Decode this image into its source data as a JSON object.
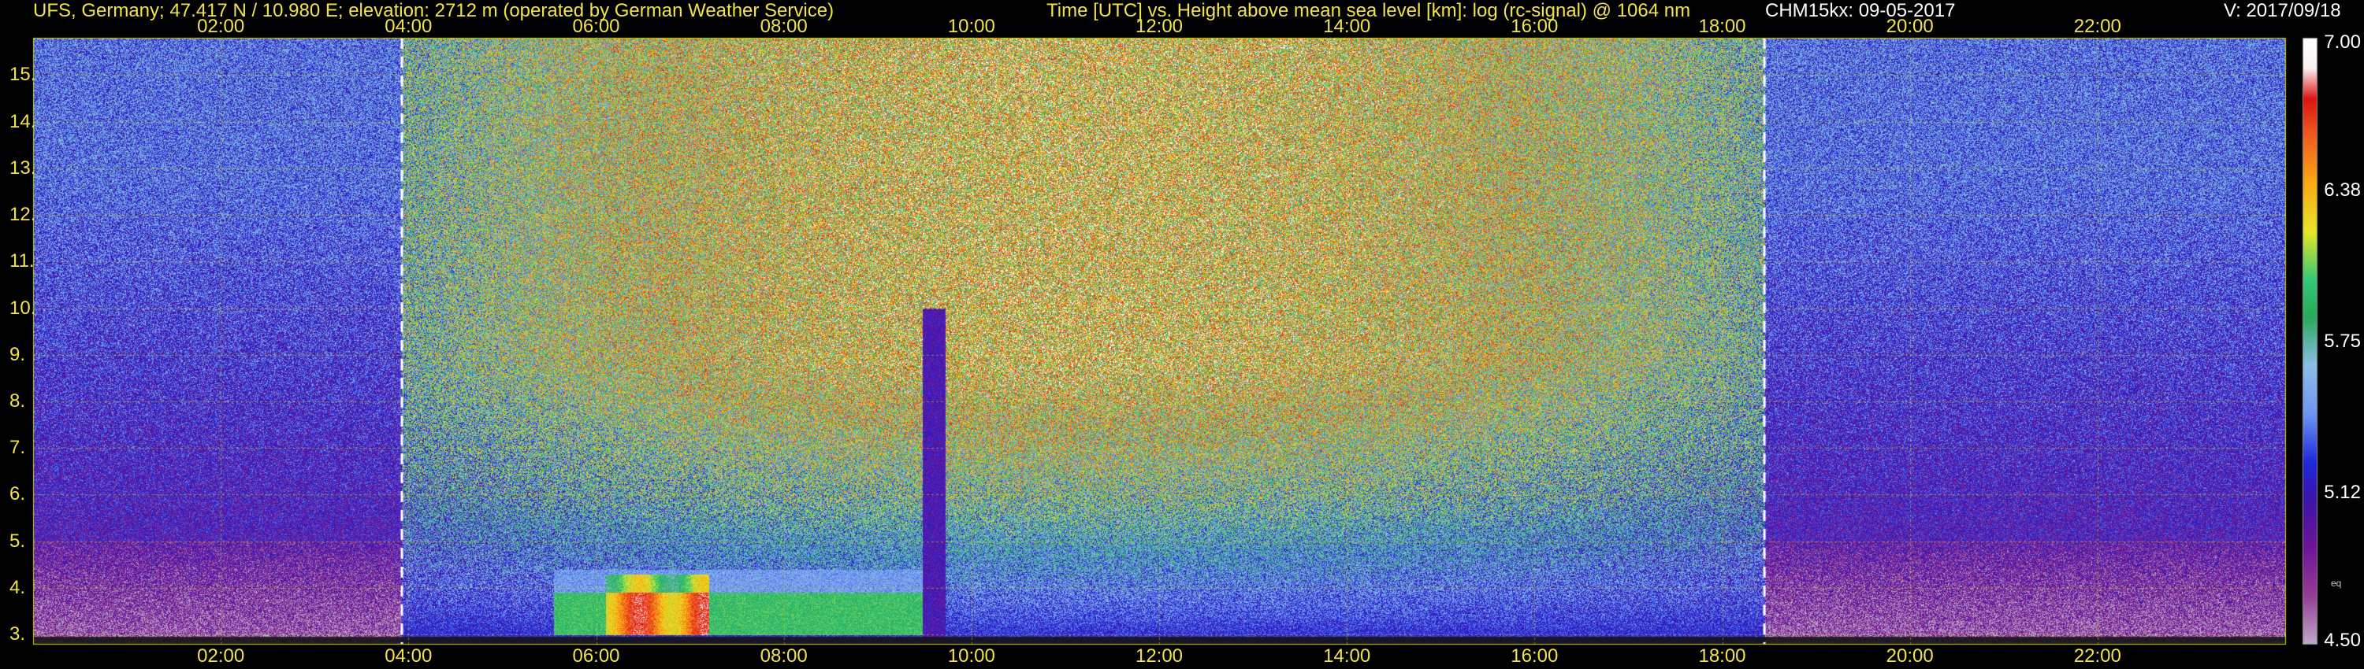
{
  "header": {
    "station": "UFS, Germany; 47.417 N / 10.980 E; elevation: 2712 m  (operated by German Weather Service)",
    "description": "Time [UTC] vs. Height above mean sea level [km]: log (rc-signal) @ 1064 nm",
    "instrument_date": "CHM15kx: 09-05-2017",
    "version": "V: 2017/09/18"
  },
  "chart_data": {
    "type": "heatmap",
    "x_ticks": [
      "02:00",
      "04:00",
      "06:00",
      "08:00",
      "10:00",
      "12:00",
      "14:00",
      "16:00",
      "18:00",
      "20:00",
      "22:00"
    ],
    "x_range_hours": [
      0,
      24
    ],
    "y_ticks": [
      "3.",
      "4.",
      "5.",
      "6.",
      "7.",
      "8.",
      "9.",
      "10.",
      "11.",
      "12.",
      "13.",
      "14.",
      "15."
    ],
    "y_range_km": [
      2.8,
      15.8
    ],
    "colorbar": {
      "labels": [
        "7.00",
        "6.38",
        "5.75",
        "5.12",
        "4.50"
      ],
      "min": 4.5,
      "max": 7.0,
      "note": "eq"
    },
    "day_markers_hours": [
      3.93,
      18.45
    ],
    "features": {
      "aerosol_layer": {
        "start_hour": 5.55,
        "end_hour": 9.5,
        "height_km": [
          3.0,
          4.4
        ]
      },
      "cloud_gap_hour": 9.6
    },
    "grid": true
  },
  "colors": {
    "text": "#f2e24a",
    "grid": "#d8d200",
    "marker": "#ffffff"
  }
}
